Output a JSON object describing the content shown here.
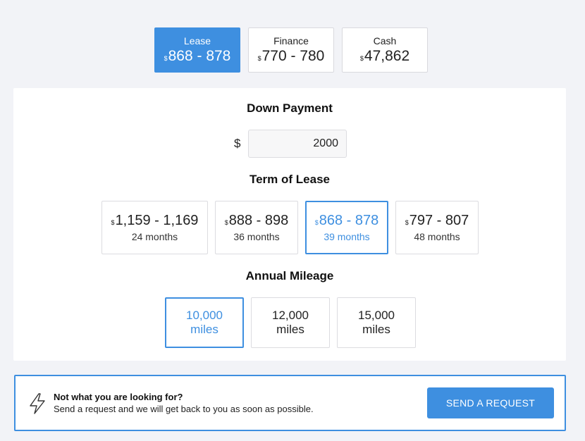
{
  "payment_tabs": [
    {
      "label": "Lease",
      "currency": "$",
      "price": "868 - 878",
      "active": true
    },
    {
      "label": "Finance",
      "currency": "$",
      "price": "770 - 780",
      "active": false
    },
    {
      "label": "Cash",
      "currency": "$",
      "price": "47,862",
      "active": false
    }
  ],
  "down_payment": {
    "title": "Down Payment",
    "currency": "$",
    "value": "2000"
  },
  "term": {
    "title": "Term of Lease",
    "options": [
      {
        "currency": "$",
        "price": "1,159 - 1,169",
        "months": "24 months",
        "active": false
      },
      {
        "currency": "$",
        "price": "888 - 898",
        "months": "36 months",
        "active": false
      },
      {
        "currency": "$",
        "price": "868 - 878",
        "months": "39 months",
        "active": true
      },
      {
        "currency": "$",
        "price": "797 - 807",
        "months": "48 months",
        "active": false
      }
    ]
  },
  "mileage": {
    "title": "Annual Mileage",
    "options": [
      {
        "value": "10,000",
        "unit": "miles",
        "active": true
      },
      {
        "value": "12,000",
        "unit": "miles",
        "active": false
      },
      {
        "value": "15,000",
        "unit": "miles",
        "active": false
      }
    ]
  },
  "banner": {
    "icon": "lightning-bolt-icon",
    "title": "Not what you are looking for?",
    "text": "Send a request and we will get back to you as soon as possible.",
    "button_label": "SEND A REQUEST"
  },
  "colors": {
    "accent": "#3e8fe0",
    "background": "#f2f3f7"
  }
}
